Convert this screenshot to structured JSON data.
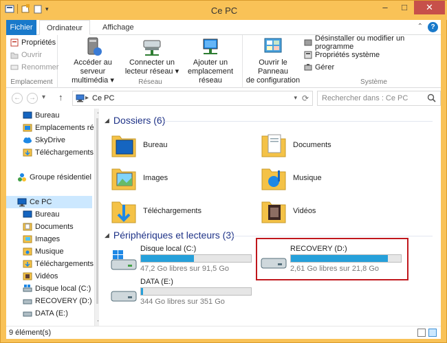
{
  "window": {
    "title": "Ce PC"
  },
  "ribbon_tabs": {
    "file": "Fichier",
    "computer": "Ordinateur",
    "view": "Affichage"
  },
  "ribbon": {
    "location": {
      "label": "Emplacement",
      "items": [
        {
          "label": "Propriétés",
          "enabled": true
        },
        {
          "label": "Ouvrir",
          "enabled": false
        },
        {
          "label": "Renommer",
          "enabled": false
        }
      ]
    },
    "network": {
      "label": "Réseau",
      "buttons": [
        {
          "line1": "Accéder au serveur",
          "line2": "multimédia ▾"
        },
        {
          "line1": "Connecter un",
          "line2": "lecteur réseau ▾"
        },
        {
          "line1": "Ajouter un",
          "line2": "emplacement réseau"
        }
      ]
    },
    "system": {
      "label": "Système",
      "panel_button": {
        "line1": "Ouvrir le Panneau",
        "line2": "de configuration"
      },
      "items": [
        "Désinstaller ou modifier un programme",
        "Propriétés système",
        "Gérer"
      ]
    }
  },
  "address": {
    "path": "Ce PC",
    "search_placeholder": "Rechercher dans : Ce PC"
  },
  "navpane": {
    "top_items": [
      "Bureau",
      "Emplacements ré",
      "SkyDrive",
      "Téléchargements"
    ],
    "homegroup": "Groupe résidentiel",
    "this_pc": "Ce PC",
    "pc_items": [
      "Bureau",
      "Documents",
      "Images",
      "Musique",
      "Téléchargements",
      "Vidéos",
      "Disque local (C:)",
      "RECOVERY (D:)",
      "DATA (E:)"
    ]
  },
  "folders": {
    "header": "Dossiers (6)",
    "items": [
      "Bureau",
      "Documents",
      "Images",
      "Musique",
      "Téléchargements",
      "Vidéos"
    ]
  },
  "drives": {
    "header": "Périphériques et lecteurs (3)",
    "items": [
      {
        "name": "Disque local (C:)",
        "free": "47,2 Go libres sur 91,5 Go",
        "used_fraction": 0.484
      },
      {
        "name": "RECOVERY (D:)",
        "free": "2,61 Go libres sur 21,8 Go",
        "used_fraction": 0.88
      },
      {
        "name": "DATA (E:)",
        "free": "344 Go libres sur 351 Go",
        "used_fraction": 0.02
      }
    ]
  },
  "status": {
    "count": "9 élément(s)"
  }
}
